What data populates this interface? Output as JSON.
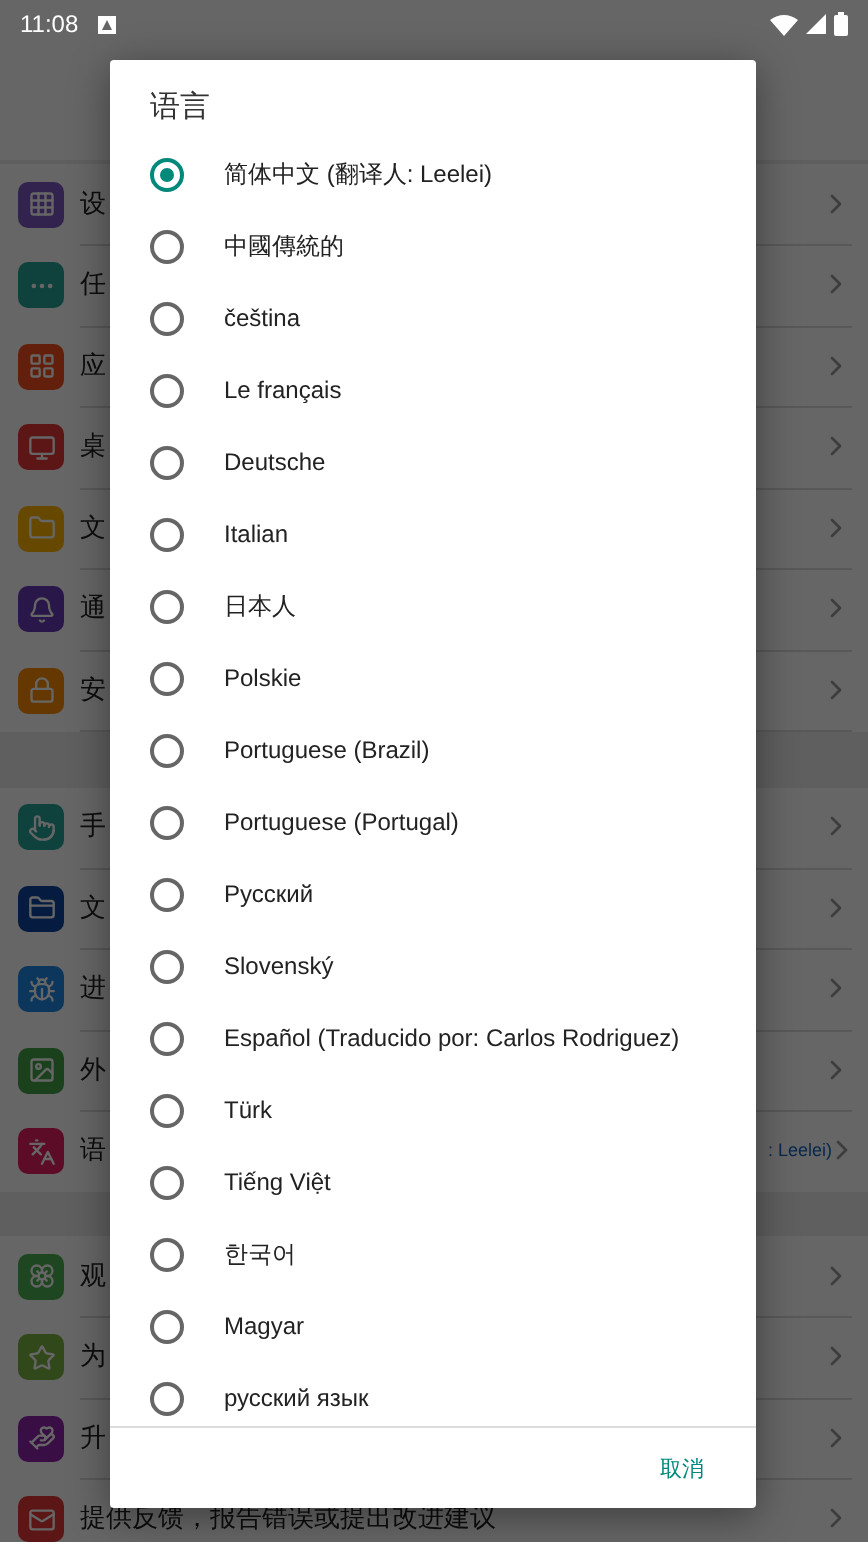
{
  "status_bar": {
    "time": "11:08"
  },
  "background": {
    "sections": [
      {
        "items": [
          {
            "label": "设"
          },
          {
            "label": "任"
          },
          {
            "label": "应"
          },
          {
            "label": "桌"
          },
          {
            "label": "文"
          },
          {
            "label": "通"
          },
          {
            "label": "安"
          }
        ]
      },
      {
        "items": [
          {
            "label": "手"
          },
          {
            "label": "文"
          },
          {
            "label": "进"
          },
          {
            "label": "外"
          },
          {
            "label": "语",
            "value": ": Leelei)"
          }
        ]
      },
      {
        "items": [
          {
            "label": "观"
          },
          {
            "label": "为"
          },
          {
            "label": "升"
          },
          {
            "label": "提供反馈，报告错误或提出改进建议"
          }
        ]
      }
    ]
  },
  "dialog": {
    "title": "语言",
    "options": [
      {
        "label": "简体中文 (翻译人: Leelei)",
        "selected": true
      },
      {
        "label": "中國傳統的",
        "selected": false
      },
      {
        "label": "čeština",
        "selected": false
      },
      {
        "label": "Le français",
        "selected": false
      },
      {
        "label": "Deutsche",
        "selected": false
      },
      {
        "label": "Italian",
        "selected": false
      },
      {
        "label": "日本人",
        "selected": false
      },
      {
        "label": "Polskie",
        "selected": false
      },
      {
        "label": "Portuguese (Brazil)",
        "selected": false
      },
      {
        "label": "Portuguese (Portugal)",
        "selected": false
      },
      {
        "label": "Русский",
        "selected": false
      },
      {
        "label": "Slovenský",
        "selected": false
      },
      {
        "label": "Español (Traducido por: Carlos Rodriguez)",
        "selected": false
      },
      {
        "label": "Türk",
        "selected": false
      },
      {
        "label": "Tiếng Việt",
        "selected": false
      },
      {
        "label": "한국어",
        "selected": false
      },
      {
        "label": "Magyar",
        "selected": false
      },
      {
        "label": "русский язык",
        "selected": false
      }
    ],
    "cancel_button": "取消"
  }
}
